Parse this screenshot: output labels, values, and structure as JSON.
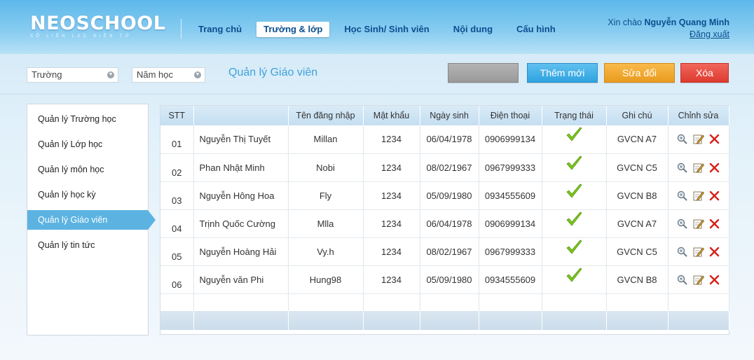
{
  "brand": {
    "name": "NEOSCHOOL",
    "tagline": "SỔ LIÊN LẠC ĐIỆN TỬ"
  },
  "nav": [
    {
      "label": "Trang chủ",
      "active": false
    },
    {
      "label": "Trường & lớp",
      "active": true
    },
    {
      "label": "Học Sinh/ Sinh viên",
      "active": false
    },
    {
      "label": "Nội dung",
      "active": false
    },
    {
      "label": "Cấu hình",
      "active": false
    }
  ],
  "user": {
    "greeting": "Xin chào",
    "name": "Nguyễn Quang Minh",
    "logout": "Đăng xuất"
  },
  "filters": {
    "school": "Trường",
    "year": "Năm học"
  },
  "page_title": "Quản lý Giáo viên",
  "buttons": {
    "blank": "",
    "add": "Thêm mới",
    "edit": "Sửa đổi",
    "delete": "Xóa"
  },
  "colors": {
    "add": "#2fa3e0",
    "edit": "#ea9b1f",
    "delete": "#de3a2f",
    "check": "#7cc41f",
    "accent": "#5cb3e2"
  },
  "sidebar": [
    {
      "label": "Quản lý Trường học",
      "active": false
    },
    {
      "label": "Quản lý Lớp học",
      "active": false
    },
    {
      "label": "Quản lý môn học",
      "active": false
    },
    {
      "label": "Quản lý học kỳ",
      "active": false
    },
    {
      "label": "Quản lý Giáo viên",
      "active": true
    },
    {
      "label": "Quản lý tin tức",
      "active": false
    }
  ],
  "table": {
    "headers": [
      "STT",
      "",
      "Tên đăng nhập",
      "Mật khẩu",
      "Ngày sinh",
      "Điện thoại",
      "Trạng thái",
      "Ghi chú",
      "Chỉnh sửa"
    ],
    "rows": [
      {
        "stt": "01",
        "name": "Nguyễn Thị Tuyết",
        "username": "Millan",
        "password": "1234",
        "dob": "06/04/1978",
        "phone": "0906999134",
        "status": "check-icon",
        "note": "GVCN A7"
      },
      {
        "stt": "02",
        "name": "Phan Nhật Minh",
        "username": "Nobi",
        "password": "1234",
        "dob": "08/02/1967",
        "phone": "0967999333",
        "status": "check-icon",
        "note": "GVCN C5"
      },
      {
        "stt": "03",
        "name": "Nguyễn Hông Hoa",
        "username": "Fly",
        "password": "1234",
        "dob": "05/09/1980",
        "phone": "0934555609",
        "status": "check-icon",
        "note": "GVCN B8"
      },
      {
        "stt": "04",
        "name": "Trịnh Quốc Cường",
        "username": "Mlla",
        "password": "1234",
        "dob": "06/04/1978",
        "phone": "0906999134",
        "status": "check-icon",
        "note": "GVCN A7"
      },
      {
        "stt": "05",
        "name": "Nguyễn Hoàng Hải",
        "username": "Vy.h",
        "password": "1234",
        "dob": "08/02/1967",
        "phone": "0967999333",
        "status": "check-icon",
        "note": "GVCN C5"
      },
      {
        "stt": "06",
        "name": "Nguyễn văn Phi",
        "username": "Hung98",
        "password": "1234",
        "dob": "05/09/1980",
        "phone": "0934555609",
        "status": "check-icon",
        "note": "GVCN B8"
      }
    ]
  }
}
